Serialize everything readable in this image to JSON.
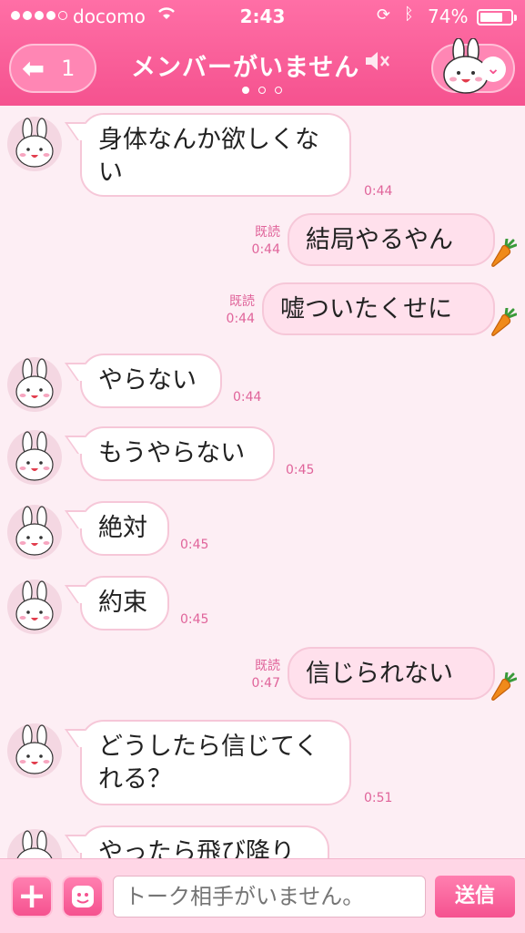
{
  "status_bar": {
    "signal_bars_filled": 4,
    "signal_bars_total": 5,
    "carrier": "docomo",
    "time": "2:43",
    "battery": "74%",
    "battery_level": 0.74
  },
  "header": {
    "back_count": "1",
    "title": "メンバーがいません",
    "page_dots": 3,
    "active_dot": 0,
    "accent_color": "#f5528f"
  },
  "messages": [
    {
      "side": "in",
      "text": "身体なんか欲しくない",
      "lines": [
        "身体なんか欲しくな",
        "い"
      ],
      "time": "0:44"
    },
    {
      "side": "out",
      "text": "結局やるやん",
      "read": "既読",
      "time": "0:44"
    },
    {
      "side": "out",
      "text": "嘘ついたくせに",
      "read": "既読",
      "time": "0:44"
    },
    {
      "side": "in",
      "text": "やらない",
      "time": "0:44"
    },
    {
      "side": "in",
      "text": "もうやらない",
      "time": "0:45"
    },
    {
      "side": "in",
      "text": "絶対",
      "time": "0:45"
    },
    {
      "side": "in",
      "text": "約束",
      "time": "0:45"
    },
    {
      "side": "out",
      "text": "信じられない",
      "read": "既読",
      "time": "0:47"
    },
    {
      "side": "in",
      "text": "どうしたら信じてくれる？",
      "lines": [
        "どうしたら信じてく",
        "れる？"
      ],
      "time": "0:51"
    },
    {
      "side": "in",
      "text": "やったら飛び降りる",
      "time": ""
    }
  ],
  "input_bar": {
    "placeholder": "トーク相手がいません。",
    "send_label": "送信",
    "icons": [
      "plus-icon",
      "sticker-icon"
    ]
  }
}
